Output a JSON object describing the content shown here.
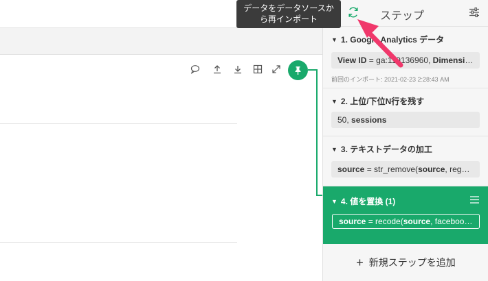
{
  "tooltip": {
    "line1": "データをデータソースか",
    "line2": "ら再インポート"
  },
  "panel": {
    "title": "ステップ"
  },
  "steps": [
    {
      "head": "1. Google Analytics データ",
      "body_bold1": "View ID",
      "body_rest1": " = ga:119136960, ",
      "body_bold2": "Dimensions",
      "body_rest2": "...",
      "meta": "前回のインポート: 2021-02-23 2:28:43 AM"
    },
    {
      "head": "2. 上位/下位N行を残す",
      "body_rest1": "50, ",
      "body_bold1": "sessions"
    },
    {
      "head": "3. テキストデータの加工",
      "body_bold1": "source",
      "body_rest1": " = str_remove(",
      "body_bold2": "source",
      "body_rest2": ", regex..."
    },
    {
      "head": "4. 値を置換 (1)",
      "body_bold1": "source",
      "body_rest1": " = recode(",
      "body_bold2": "source",
      "body_rest2": ", facebook ..."
    }
  ],
  "add_step": {
    "plus": "+",
    "label": "新規ステップを追加"
  },
  "colors": {
    "accent": "#19a96b",
    "arrow": "#f0386b",
    "tooltip_bg": "#3b3b3b"
  }
}
